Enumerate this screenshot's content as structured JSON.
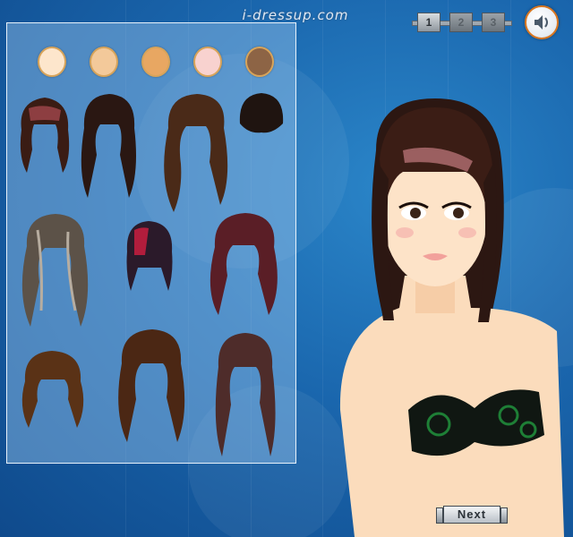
{
  "site": {
    "title": "i-dressup.com"
  },
  "steps": [
    "1",
    "2",
    "3"
  ],
  "active_step": "1",
  "sound_icon": "speaker-icon",
  "skin_tones": [
    "#fde6cc",
    "#f3c99a",
    "#e8a762",
    "#f8d2cf",
    "#8d6445"
  ],
  "hair_styles": [
    {
      "name": "short-bob-bangs",
      "color": "#3a1c14"
    },
    {
      "name": "long-straight-dark",
      "color": "#2a1712"
    },
    {
      "name": "long-wavy-brown",
      "color": "#4a2a18"
    },
    {
      "name": "updo-bun",
      "color": "#1f1410"
    },
    {
      "name": "wavy-ash-highlights",
      "color": "#5c5248"
    },
    {
      "name": "bob-red-streak",
      "color": "#2b1a2a"
    },
    {
      "name": "wavy-burgundy",
      "color": "#5a1e26"
    },
    {
      "name": "shoulder-curly-brown",
      "color": "#5a3216"
    },
    {
      "name": "long-wavy-chestnut",
      "color": "#4b2714"
    },
    {
      "name": "long-straight-mauve",
      "color": "#4e2c2a"
    }
  ],
  "next_label": "Next"
}
